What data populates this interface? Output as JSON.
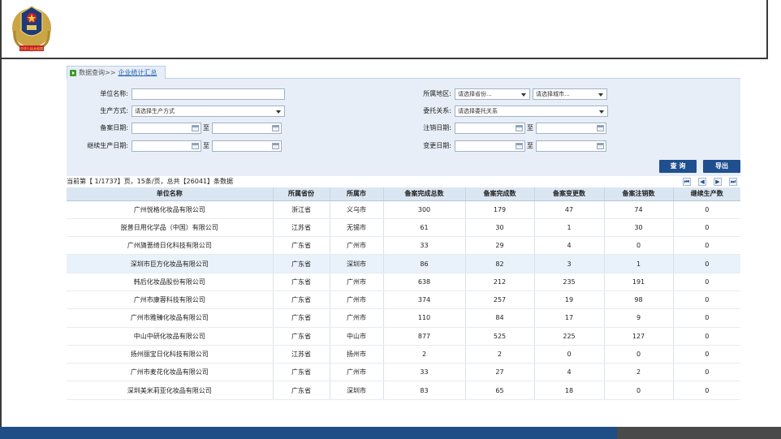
{
  "header": {
    "emblem_text": "中华人民共和国"
  },
  "breadcrumb": {
    "root": "数据查询>>",
    "current": "企业统计汇总"
  },
  "form": {
    "company_name_label": "单位名称:",
    "company_name_value": "",
    "region_label": "所属地区:",
    "province_select": "请选择省份...",
    "city_select": "请选择城市...",
    "production_mode_label": "生产方式:",
    "production_mode_select": "请选择生产方式",
    "entrust_label": "委托关系:",
    "entrust_select": "请选择委托关系",
    "record_date_label": "备案日期:",
    "cancel_date_label": "注销日期:",
    "continue_date_label": "继续生产日期:",
    "change_date_label": "变更日期:",
    "to_label": "至"
  },
  "buttons": {
    "query": "查 询",
    "export": "导出"
  },
  "status": {
    "text": "当前第【 1/1737】页，15条/页，总共【26041】条数据"
  },
  "pager": {
    "first": "⏮",
    "prev": "◀",
    "next": "▶",
    "last": "⏭"
  },
  "table": {
    "columns": [
      "单位名称",
      "所属省份",
      "所属市",
      "备案完成总数",
      "备案完成数",
      "备案变更数",
      "备案注销数",
      "继续生产数"
    ],
    "rows": [
      [
        "广州悦格化妆品有限公司",
        "浙江省",
        "义乌市",
        "300",
        "179",
        "47",
        "74",
        "0"
      ],
      [
        "脱普日用化学品（中国）有限公司",
        "江苏省",
        "无锡市",
        "61",
        "30",
        "1",
        "30",
        "0"
      ],
      [
        "广州旖蔷绮日化科技有限公司",
        "广东省",
        "广州市",
        "33",
        "29",
        "4",
        "0",
        "0"
      ],
      [
        "深圳市巨方化妆品有限公司",
        "广东省",
        "深圳市",
        "86",
        "82",
        "3",
        "1",
        "0"
      ],
      [
        "韩后化妆品股份有限公司",
        "广东省",
        "广州市",
        "638",
        "212",
        "235",
        "191",
        "0"
      ],
      [
        "广州市康蓉科技有限公司",
        "广东省",
        "广州市",
        "374",
        "257",
        "19",
        "98",
        "0"
      ],
      [
        "广州市雅臻化妆品有限公司",
        "广东省",
        "广州市",
        "110",
        "84",
        "17",
        "9",
        "0"
      ],
      [
        "中山中研化妆品有限公司",
        "广东省",
        "中山市",
        "877",
        "525",
        "225",
        "127",
        "0"
      ],
      [
        "扬州丽宝日化科技有限公司",
        "江苏省",
        "扬州市",
        "2",
        "2",
        "0",
        "0",
        "0"
      ],
      [
        "广州市麦花化妆品有限公司",
        "广东省",
        "广州市",
        "33",
        "27",
        "4",
        "2",
        "0"
      ],
      [
        "深圳美米莉亚化妆品有限公司",
        "广东省",
        "深圳市",
        "83",
        "65",
        "18",
        "0",
        "0"
      ]
    ]
  },
  "colors": {
    "footer_blue": "#1f4e86",
    "button_blue": "#1f4f8f",
    "panel_bg": "#e8eef7"
  }
}
